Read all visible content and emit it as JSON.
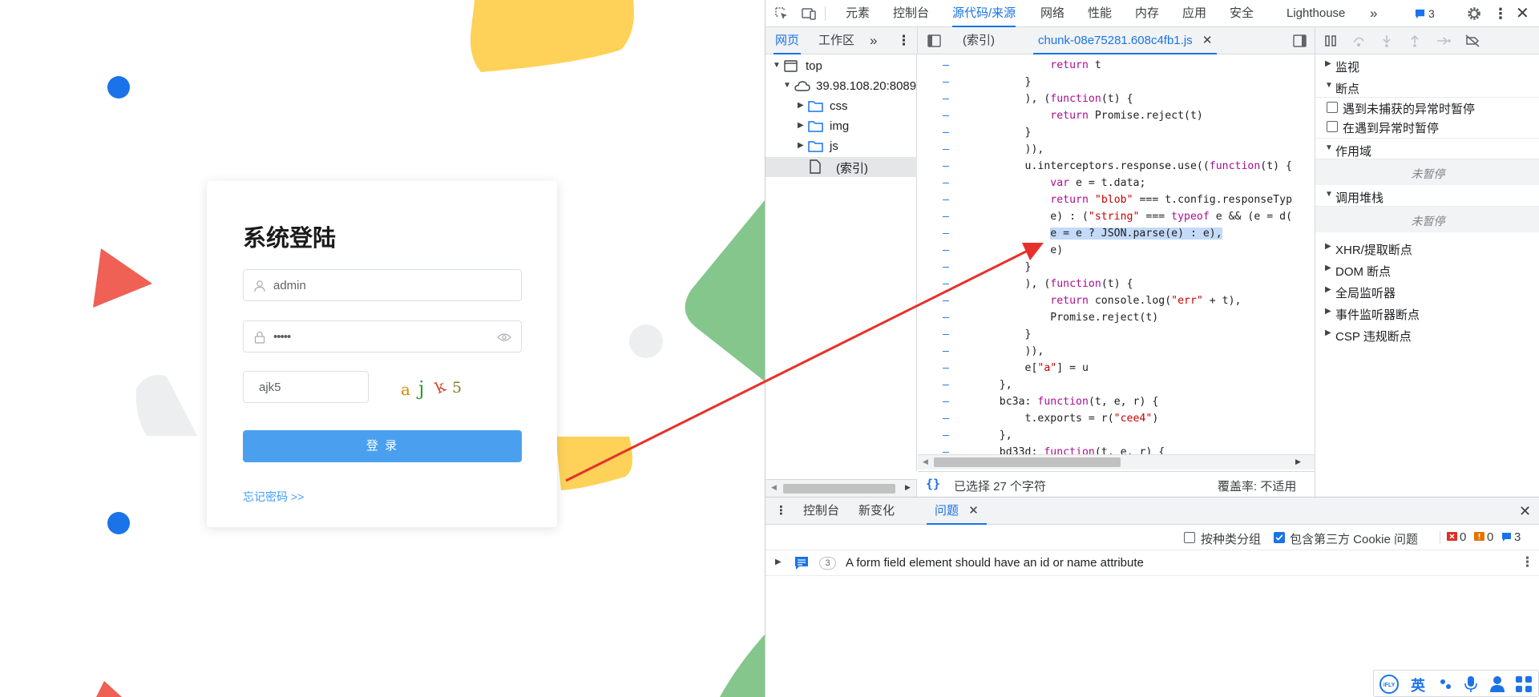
{
  "login": {
    "title": "系统登陆",
    "username_value": "admin",
    "password_value": "•••••",
    "captcha_value": "ajk5",
    "captcha_chars": [
      "a",
      "j",
      "k",
      "5"
    ],
    "login_button": "登 录",
    "forgot_link": "忘记密码 >>"
  },
  "devtools": {
    "top_tabs": [
      "元素",
      "控制台",
      "源代码/来源",
      "网络",
      "性能",
      "内存",
      "应用",
      "安全",
      "Lighthouse"
    ],
    "active_top_tab": "源代码/来源",
    "issues_badge_count": "3",
    "navigator_tabs": [
      "网页",
      "工作区"
    ],
    "editor_tabs": [
      "(索引)",
      "chunk-08e75281.608c4fb1.js"
    ],
    "active_editor_tab": "chunk-08e75281.608c4fb1.js",
    "file_tree": [
      {
        "label": "top",
        "depth": 0,
        "icon": "window"
      },
      {
        "label": "39.98.108.20:8089",
        "depth": 1,
        "icon": "cloud"
      },
      {
        "label": "css",
        "depth": 2,
        "icon": "folder"
      },
      {
        "label": "img",
        "depth": 2,
        "icon": "folder"
      },
      {
        "label": "js",
        "depth": 2,
        "icon": "folder"
      },
      {
        "label": "(索引)",
        "depth": 2,
        "icon": "file"
      }
    ],
    "code_lines": [
      {
        "gutter": "–",
        "text": "            return t"
      },
      {
        "gutter": "–",
        "text": "        }"
      },
      {
        "gutter": "–",
        "text": "        ), (function(t) {"
      },
      {
        "gutter": "–",
        "text": "            return Promise.reject(t)"
      },
      {
        "gutter": "–",
        "text": "        }"
      },
      {
        "gutter": "–",
        "text": "        )),"
      },
      {
        "gutter": "–",
        "text": "        u.interceptors.response.use((function(t) {"
      },
      {
        "gutter": "–",
        "text": "            var e = t.data;"
      },
      {
        "gutter": "–",
        "text": "            return \"blob\" === t.config.responseTyp"
      },
      {
        "gutter": "–",
        "text": "            e) : (\"string\" === typeof e && (e = d("
      },
      {
        "gutter": "–",
        "text": "            e = e ? JSON.parse(e) : e),"
      },
      {
        "gutter": "–",
        "text": "            e)"
      },
      {
        "gutter": "–",
        "text": "        }"
      },
      {
        "gutter": "–",
        "text": "        ), (function(t) {"
      },
      {
        "gutter": "–",
        "text": "            return console.log(\"err\" + t),"
      },
      {
        "gutter": "–",
        "text": "            Promise.reject(t)"
      },
      {
        "gutter": "–",
        "text": "        }"
      },
      {
        "gutter": "–",
        "text": "        )),"
      },
      {
        "gutter": "–",
        "text": "        e[\"a\"] = u"
      },
      {
        "gutter": "–",
        "text": "    },"
      },
      {
        "gutter": "–",
        "text": "    bc3a: function(t, e, r) {"
      },
      {
        "gutter": "–",
        "text": "        t.exports = r(\"cee4\")"
      },
      {
        "gutter": "–",
        "text": "    },"
      },
      {
        "gutter": "–",
        "text": "    bd33d: function(t, e, r) {"
      }
    ],
    "status_selected": "已选择 27 个字符",
    "status_coverage": "覆盖率: 不适用",
    "debugger": {
      "sections": [
        {
          "label": "监视",
          "expanded": false
        },
        {
          "label": "断点",
          "expanded": true
        }
      ],
      "breakpoint_options": [
        "遇到未捕获的异常时暂停",
        "在遇到异常时暂停"
      ],
      "scope_label": "作用域",
      "scope_state": "未暂停",
      "callstack_label": "调用堆栈",
      "callstack_state": "未暂停",
      "more_sections": [
        "XHR/提取断点",
        "DOM 断点",
        "全局监听器",
        "事件监听器断点",
        "CSP 违规断点"
      ]
    },
    "drawer": {
      "tabs": [
        "控制台",
        "新变化",
        "问题"
      ],
      "active_tab": "问题",
      "group_by_category": "按种类分组",
      "include_third_party": "包含第三方 Cookie 问题",
      "error_count": "0",
      "warning_count": "0",
      "info_count": "3",
      "issue_count": "3",
      "issue_text": "A form field element should have an id or name attribute"
    }
  },
  "colors": {
    "accent": "#1a73e8",
    "login_button": "#4aa0ef",
    "arrow": "#e8302a"
  }
}
